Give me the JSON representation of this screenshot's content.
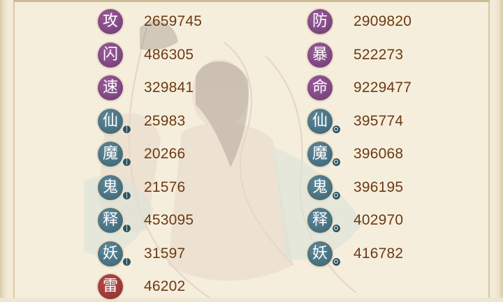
{
  "stats": {
    "left": [
      {
        "glyph": "攻",
        "value": "2659745",
        "style": "purple",
        "sub": "none"
      },
      {
        "glyph": "闪",
        "value": "486305",
        "style": "purple",
        "sub": "none"
      },
      {
        "glyph": "速",
        "value": "329841",
        "style": "purple",
        "sub": "none"
      },
      {
        "glyph": "仙",
        "value": "25983",
        "style": "teal",
        "sub": "bar"
      },
      {
        "glyph": "魔",
        "value": "20266",
        "style": "teal",
        "sub": "bar"
      },
      {
        "glyph": "鬼",
        "value": "21576",
        "style": "teal",
        "sub": "bar"
      },
      {
        "glyph": "释",
        "value": "453095",
        "style": "teal",
        "sub": "bar"
      },
      {
        "glyph": "妖",
        "value": "31597",
        "style": "teal",
        "sub": "bar"
      },
      {
        "glyph": "雷",
        "value": "46202",
        "style": "red",
        "sub": "none"
      }
    ],
    "right": [
      {
        "glyph": "防",
        "value": "2909820",
        "style": "purple",
        "sub": "none"
      },
      {
        "glyph": "暴",
        "value": "522273",
        "style": "purple",
        "sub": "none"
      },
      {
        "glyph": "命",
        "value": "9229477",
        "style": "purple",
        "sub": "none"
      },
      {
        "glyph": "仙",
        "value": "395774",
        "style": "teal",
        "sub": "ring"
      },
      {
        "glyph": "魔",
        "value": "396068",
        "style": "teal",
        "sub": "ring"
      },
      {
        "glyph": "鬼",
        "value": "396195",
        "style": "teal",
        "sub": "ring"
      },
      {
        "glyph": "释",
        "value": "402970",
        "style": "teal",
        "sub": "ring"
      },
      {
        "glyph": "妖",
        "value": "416782",
        "style": "teal",
        "sub": "ring"
      }
    ]
  },
  "colors": {
    "value_text": "#6b3a12",
    "badge_purple": "#7b4580",
    "badge_teal": "#46707f",
    "badge_red": "#9c3436",
    "panel_bg": "#f6eedd"
  }
}
